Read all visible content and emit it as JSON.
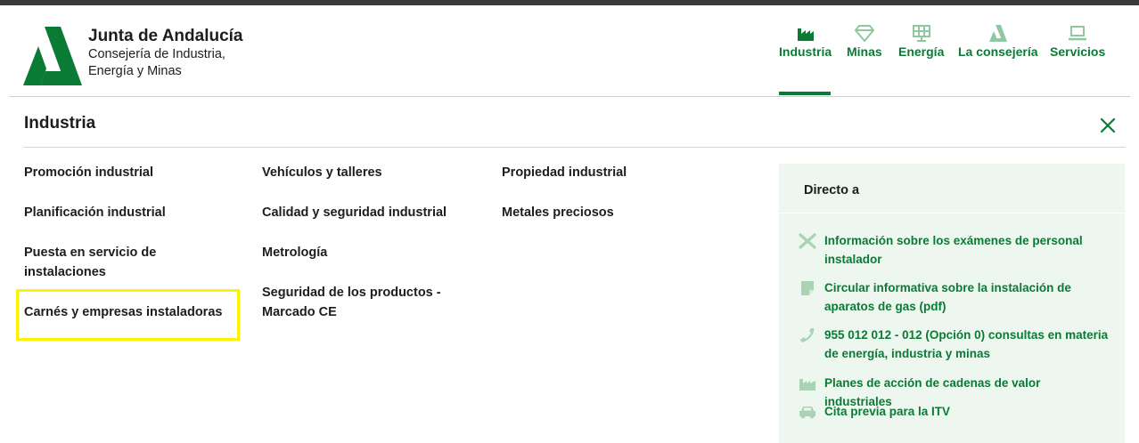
{
  "brand": {
    "title": "Junta de Andalucía",
    "subtitle_line1": "Consejería de Industria,",
    "subtitle_line2": "Energía y Minas",
    "color": "#0b7a35"
  },
  "nav": {
    "items": [
      {
        "label": "Industria",
        "icon": "factory-icon",
        "active": true
      },
      {
        "label": "Minas",
        "icon": "diamond-icon"
      },
      {
        "label": "Energía",
        "icon": "solar-panel-icon"
      },
      {
        "label": "La consejería",
        "icon": "andalucia-a-icon"
      },
      {
        "label": "Servicios",
        "icon": "laptop-icon"
      }
    ]
  },
  "section": {
    "title": "Industria",
    "close_icon": "close-icon"
  },
  "menu": {
    "col1": [
      {
        "label": "Promoción industrial"
      },
      {
        "label": "Planificación industrial"
      },
      {
        "line1": "Puesta en servicio de",
        "line2": "instalaciones"
      },
      {
        "label": "Carnés y empresas instaladoras",
        "highlighted": true
      }
    ],
    "col2": [
      {
        "label": "Vehículos y talleres"
      },
      {
        "label": "Calidad y seguridad industrial"
      },
      {
        "label": "Metrología"
      },
      {
        "line1": "Seguridad de los productos -",
        "line2": "Marcado CE"
      }
    ],
    "col3": [
      {
        "label": "Propiedad industrial"
      },
      {
        "label": "Metales preciosos"
      }
    ]
  },
  "direct": {
    "title": "Directo a",
    "items": [
      {
        "icon": "tools-icon",
        "line1": "Información sobre los exámenes de personal",
        "line2": "instalador"
      },
      {
        "icon": "document-icon",
        "line1": "Circular informativa sobre la instalación de",
        "line2": "aparatos de gas (pdf)"
      },
      {
        "icon": "phone-icon",
        "line1": "955 012 012 - 012 (Opción 0) consultas en materia",
        "line2": "de energía, industria y minas"
      },
      {
        "icon": "factory-icon",
        "line1": "Planes de acción de cadenas de valor industriales"
      },
      {
        "icon": "car-icon",
        "line1": "Cita previa para la ITV"
      }
    ]
  },
  "colors": {
    "accent": "#0b7a35",
    "aside_bg": "#edf7ef",
    "highlight": "#fff200",
    "icon_muted": "#a9d3b4"
  }
}
